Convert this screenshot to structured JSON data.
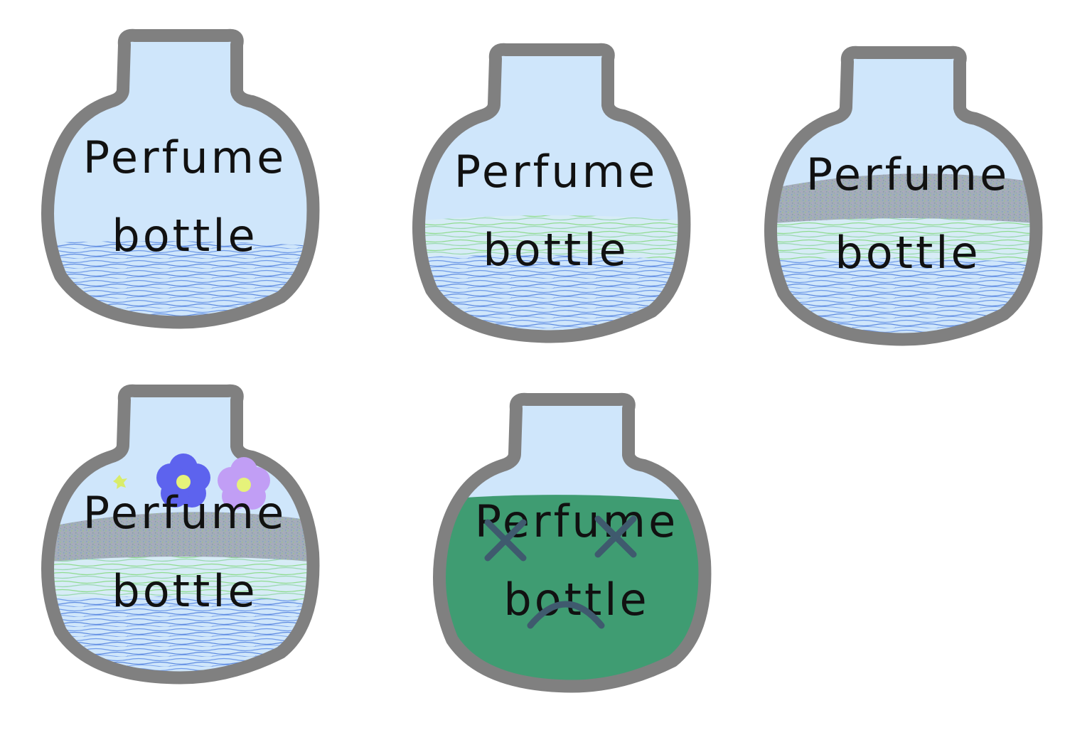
{
  "bottles": [
    {
      "id": "bottle-1",
      "line1": "Perfume",
      "line2": "bottle",
      "fill_layers": [
        "blue-liquid"
      ],
      "decorations": []
    },
    {
      "id": "bottle-2",
      "line1": "Perfume",
      "line2": "bottle",
      "fill_layers": [
        "blue-liquid",
        "green-liquid"
      ],
      "decorations": []
    },
    {
      "id": "bottle-3",
      "line1": "Perfume",
      "line2": "bottle",
      "fill_layers": [
        "blue-liquid",
        "green-liquid",
        "speckled-layer"
      ],
      "decorations": []
    },
    {
      "id": "bottle-4",
      "line1": "Perfume",
      "line2": "bottle",
      "fill_layers": [
        "blue-liquid",
        "green-liquid",
        "speckled-layer"
      ],
      "decorations": [
        "blue-flower-icon",
        "purple-flower-icon",
        "sparkle-icon"
      ]
    },
    {
      "id": "bottle-5",
      "line1": "Perfume",
      "line2": "bottle",
      "fill_layers": [
        "dark-green-liquid"
      ],
      "decorations": [
        "x-eyes-icon",
        "frown-icon"
      ]
    }
  ],
  "colors": {
    "glass": "#cfe6fb",
    "outline": "#808080",
    "blue_liquid": "#6f9ae8",
    "green_liquid": "#9fe0a0",
    "speckle": "#9aa7b5",
    "dark_green": "#3f9c72",
    "blue_flower": "#5d63ee",
    "purple_flower": "#c19ef5",
    "flower_center": "#e6f27a",
    "face": "#3f5a6e"
  }
}
